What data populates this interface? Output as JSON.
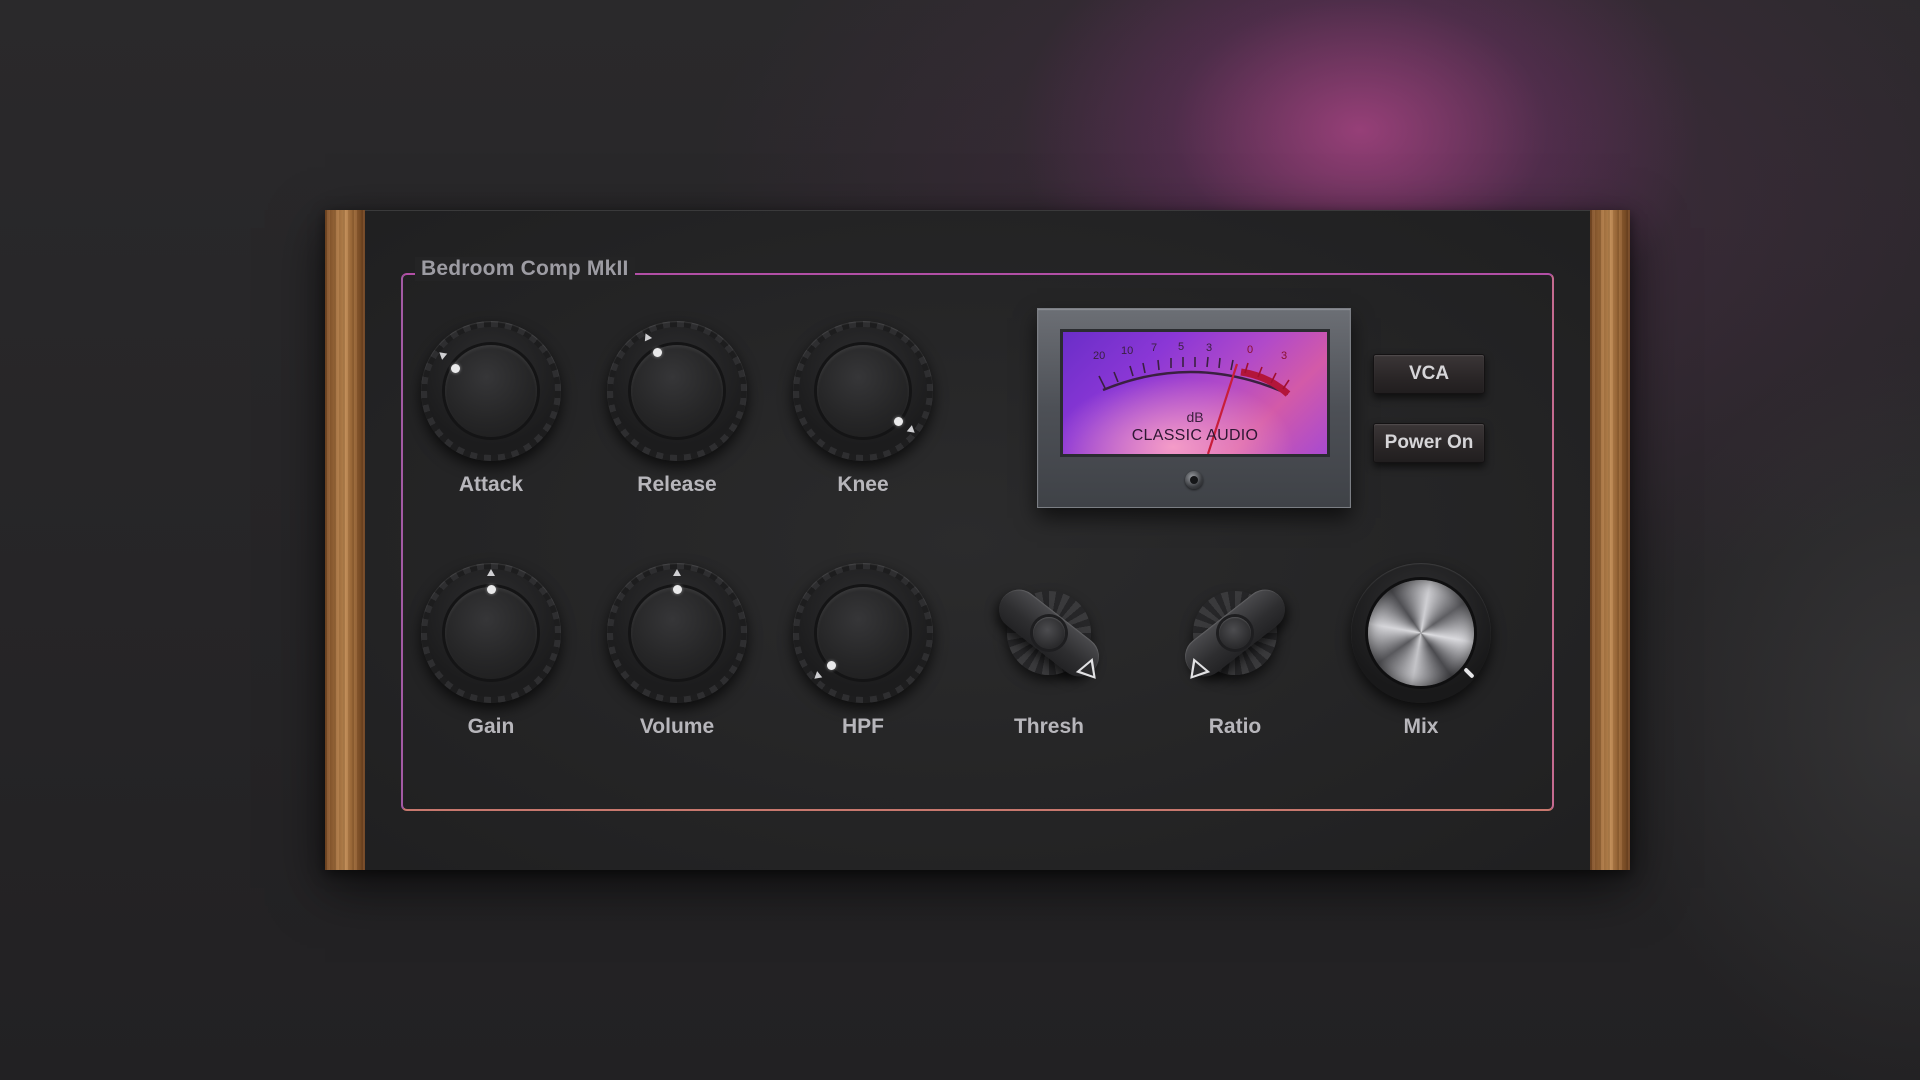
{
  "device": {
    "name": "Bedroom Comp MkII"
  },
  "colors": {
    "frame_accent": "#b24fa6",
    "meter_face": "#8b37d6",
    "meter_needle": "#c81e3a",
    "wood": "#a8733f"
  },
  "knobs_top": [
    {
      "id": "attack",
      "label": "Attack",
      "icon": "knob-icon"
    },
    {
      "id": "release",
      "label": "Release",
      "icon": "knob-icon"
    },
    {
      "id": "knee",
      "label": "Knee",
      "icon": "knob-icon"
    }
  ],
  "knobs_bottom": [
    {
      "id": "gain",
      "label": "Gain",
      "icon": "knob-icon"
    },
    {
      "id": "volume",
      "label": "Volume",
      "icon": "knob-icon"
    },
    {
      "id": "hpf",
      "label": "HPF",
      "icon": "knob-icon"
    },
    {
      "id": "thresh",
      "label": "Thresh",
      "icon": "selector-knob-icon"
    },
    {
      "id": "ratio",
      "label": "Ratio",
      "icon": "selector-knob-icon"
    },
    {
      "id": "mix",
      "label": "Mix",
      "icon": "metal-knob-icon"
    }
  ],
  "meter": {
    "scale_labels": [
      "20",
      "10",
      "7",
      "5",
      "3",
      "0",
      "3"
    ],
    "unit": "dB",
    "brand": "CLASSIC AUDIO"
  },
  "buttons": {
    "vca": "VCA",
    "power": "Power On"
  }
}
